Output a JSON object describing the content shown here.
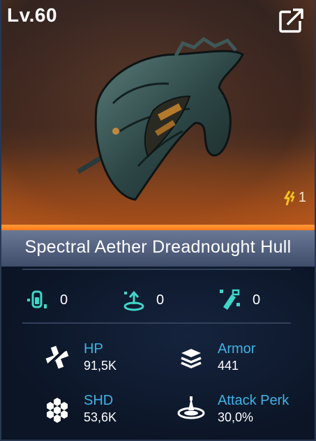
{
  "card": {
    "level": "Lv.60",
    "count": "1",
    "title": "Spectral Aether Dreadnought Hull"
  },
  "perks": [
    {
      "icon": "capsule-perk-icon",
      "value": "0"
    },
    {
      "icon": "beacon-perk-icon",
      "value": "0"
    },
    {
      "icon": "module-perk-icon",
      "value": "0"
    }
  ],
  "stats": [
    {
      "icon": "repair-cross-icon",
      "label": "HP",
      "value": "91,5K"
    },
    {
      "icon": "armor-layers-icon",
      "label": "Armor",
      "value": "441"
    },
    {
      "icon": "shield-hex-icon",
      "label": "SHD",
      "value": "53,6K"
    },
    {
      "icon": "attack-perk-icon",
      "label": "Attack Perk",
      "value": "30,0%"
    }
  ],
  "colors": {
    "accent_orange": "#ff7a18",
    "stat_label_blue": "#3fb3e6",
    "perk_icon_teal": "#3fd6c8"
  }
}
